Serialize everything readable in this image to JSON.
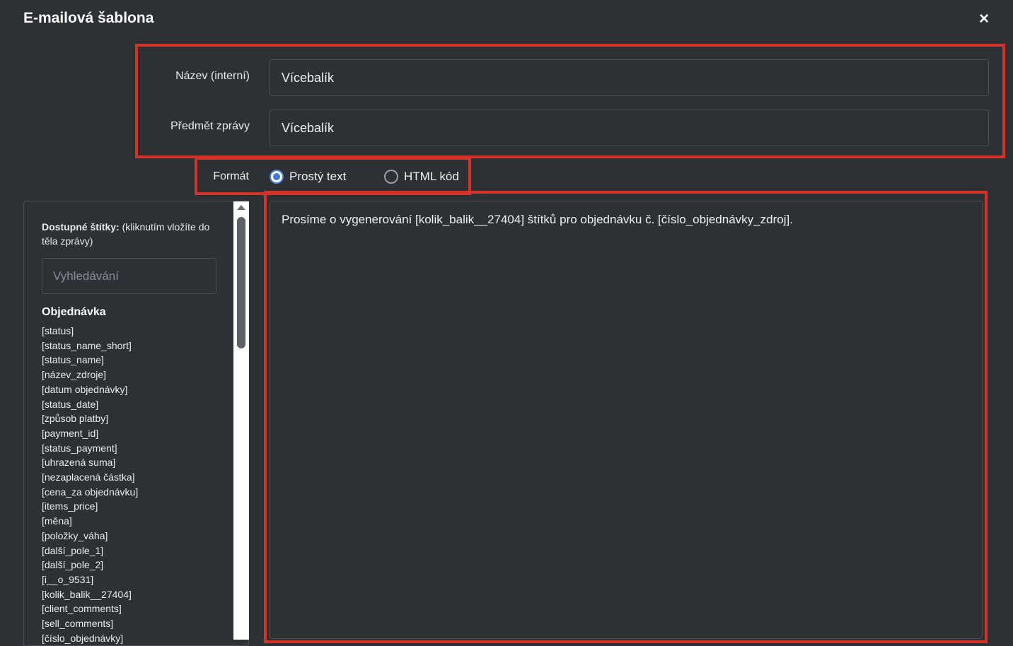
{
  "dialog": {
    "title": "E-mailová šablona",
    "close_label": "×"
  },
  "form": {
    "name_label": "Název (interní)",
    "name_value": "Vícebalík",
    "subject_label": "Předmět zprávy",
    "subject_value": "Vícebalík",
    "format_label": "Formát",
    "format_options": [
      {
        "label": "Prostý text",
        "checked": true
      },
      {
        "label": "HTML kód",
        "checked": false
      }
    ],
    "body_text": "Prosíme o vygenerování [kolik_balik__27404] štítků pro objednávku č. [číslo_objednávky_zdroj]."
  },
  "tags_panel": {
    "help_bold": "Dostupné štítky:",
    "help_text": " (kliknutím vložíte do těla zprávy)",
    "search_placeholder": "Vyhledávání",
    "group_title": "Objednávka",
    "tags": [
      "[status]",
      "[status_name_short]",
      "[status_name]",
      "[název_zdroje]",
      "[datum objednávky]",
      "[status_date]",
      "[způsob platby]",
      "[payment_id]",
      "[status_payment]",
      "[uhrazená suma]",
      "[nezaplacená částka]",
      "[cena_za objednávku]",
      "[items_price]",
      "[měna]",
      "[položky_váha]",
      "[další_pole_1]",
      "[další_pole_2]",
      "[i__o_9531]",
      "[kolik_balik__27404]",
      "[client_comments]",
      "[sell_comments]",
      "[číslo_objednávky]"
    ]
  },
  "colors": {
    "background": "#2d3035",
    "highlight_border": "#d5322a",
    "radio_accent": "#3f7be0"
  }
}
